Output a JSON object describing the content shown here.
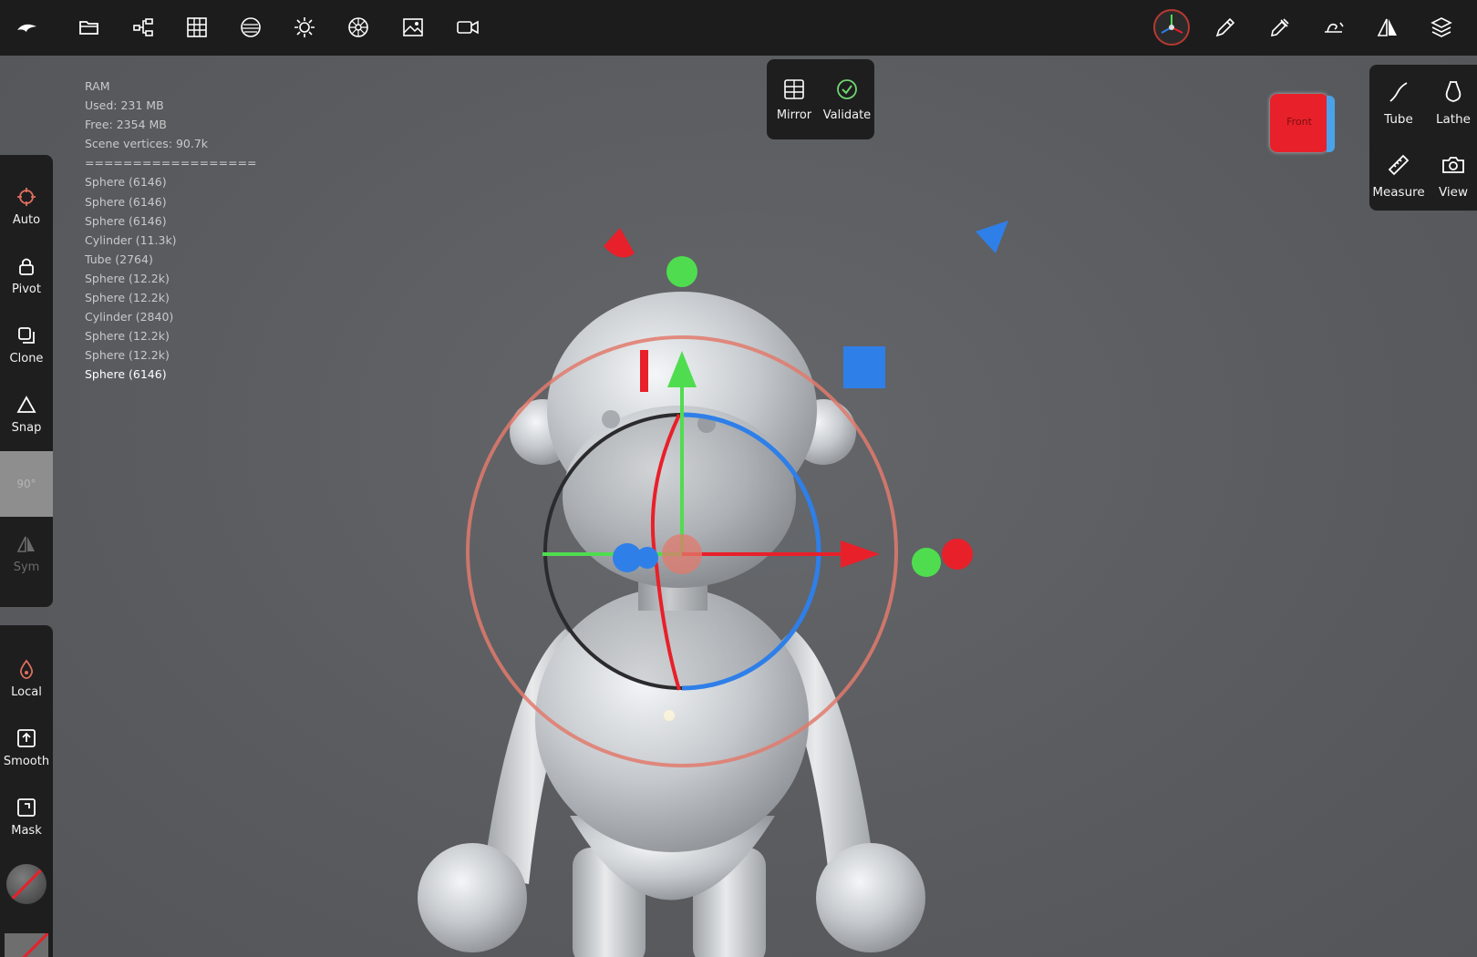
{
  "stats": {
    "title": "RAM",
    "used": "Used: 231 MB",
    "free": "Free: 2354 MB",
    "vertices": "Scene vertices: 90.7k",
    "separator": "==================",
    "objects": [
      "Sphere (6146)",
      "Sphere (6146)",
      "Sphere (6146)",
      "Cylinder (11.3k)",
      "Tube (2764)",
      "Sphere (12.2k)",
      "Sphere (12.2k)",
      "Cylinder (2840)",
      "Sphere (12.2k)",
      "Sphere (12.2k)",
      "Sphere (6146)"
    ]
  },
  "top_panel": {
    "mirror": "Mirror",
    "validate": "Validate"
  },
  "right_panel": {
    "tube": "Tube",
    "lathe": "Lathe",
    "measure": "Measure",
    "view": "View"
  },
  "left_tools": {
    "auto": "Auto",
    "pivot": "Pivot",
    "clone": "Clone",
    "snap": "Snap",
    "snap_angle": "90°",
    "sym": "Sym"
  },
  "left_tools2": {
    "local": "Local",
    "smooth": "Smooth",
    "mask": "Mask"
  },
  "cube": {
    "front": "Front"
  },
  "colors": {
    "axis_x": "#e8202a",
    "axis_y": "#4fdd4f",
    "axis_z": "#2f7fe8",
    "gizmo_ring": "#e27a6c",
    "topbar": "#1c1c1d",
    "validate": "#6fd66f"
  },
  "icons": [
    "nomad-logo-icon",
    "folder-icon",
    "scene-tree-icon",
    "grid-icon",
    "material-icon",
    "light-icon",
    "postprocess-icon",
    "background-image-icon",
    "camera-icon",
    "gnomon-icon",
    "pen-icon",
    "eyedropper-icon",
    "stroke-icon",
    "symmetry-icon",
    "layers-icon"
  ]
}
